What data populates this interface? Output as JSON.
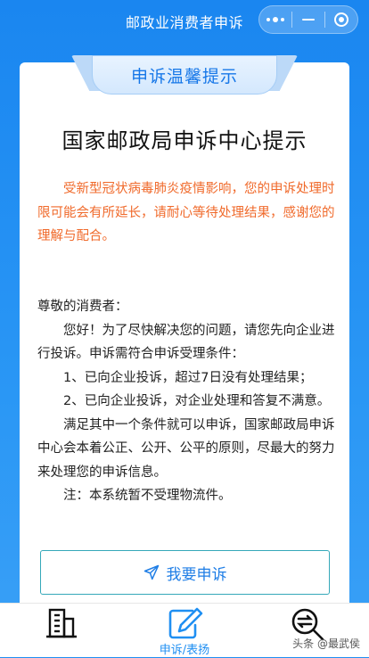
{
  "header": {
    "title": "邮政业消费者申诉"
  },
  "capsule": {
    "more_icon": "more-dots-icon",
    "minimize_icon": "minimize-icon",
    "close_icon": "target-close-icon"
  },
  "ribbon": {
    "label": "申诉温馨提示"
  },
  "card": {
    "title": "国家邮政局申诉中心提示",
    "notice": "受新型冠状病毒肺炎疫情影响，您的申诉处理时限可能会有所延长，请耐心等待处理结果，感谢您的理解与配合。",
    "greeting": "尊敬的消费者：",
    "para1": "您好！为了尽快解决您的问题，请您先向企业进行投诉。申诉需符合申诉受理条件：",
    "cond1": "1、已向企业投诉，超过7日没有处理结果；",
    "cond2": "2、已向企业投诉，对企业处理和答复不满意。",
    "para2": "满足其中一个条件就可以申诉，国家邮政局申诉中心会本着公正、公开、公平的原则，尽最大的努力来处理您的申诉信息。",
    "note": "注：本系统暂不受理物流件。"
  },
  "complain_button": {
    "label": "我要申诉",
    "icon": "paper-plane-icon"
  },
  "tabs": [
    {
      "label": "",
      "icon": "building-icon"
    },
    {
      "label": "申诉/表扬",
      "icon": "edit-icon",
      "active": true
    },
    {
      "label": "",
      "icon": "search-icon"
    }
  ],
  "watermark": "头条 @最武侯",
  "colors": {
    "primary": "#1f8ff2",
    "notice": "#f06a2b",
    "button_border": "#35a8b9"
  }
}
